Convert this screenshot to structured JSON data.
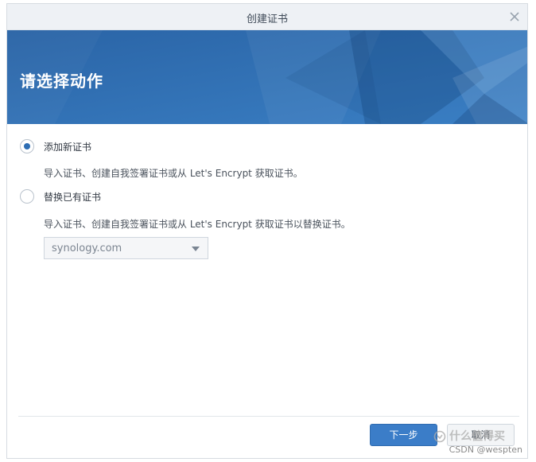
{
  "dialog": {
    "title": "创建证书",
    "banner_title": "请选择动作"
  },
  "options": [
    {
      "label": "添加新证书",
      "description": "导入证书、创建自我签署证书或从 Let's Encrypt 获取证书。",
      "checked": true
    },
    {
      "label": "替换已有证书",
      "description": "导入证书、创建自我签署证书或从 Let's Encrypt 获取证书以替换证书。",
      "checked": false
    }
  ],
  "certificate_select": {
    "value": "synology.com"
  },
  "footer": {
    "next_label": "下一步",
    "cancel_label": "取消"
  },
  "watermark": {
    "brand": "什么值得买",
    "credit": "CSDN @wespten"
  },
  "colors": {
    "banner": "#2f6fb1",
    "accent": "#3b7dc8",
    "radio_dot": "#2d6db3"
  }
}
